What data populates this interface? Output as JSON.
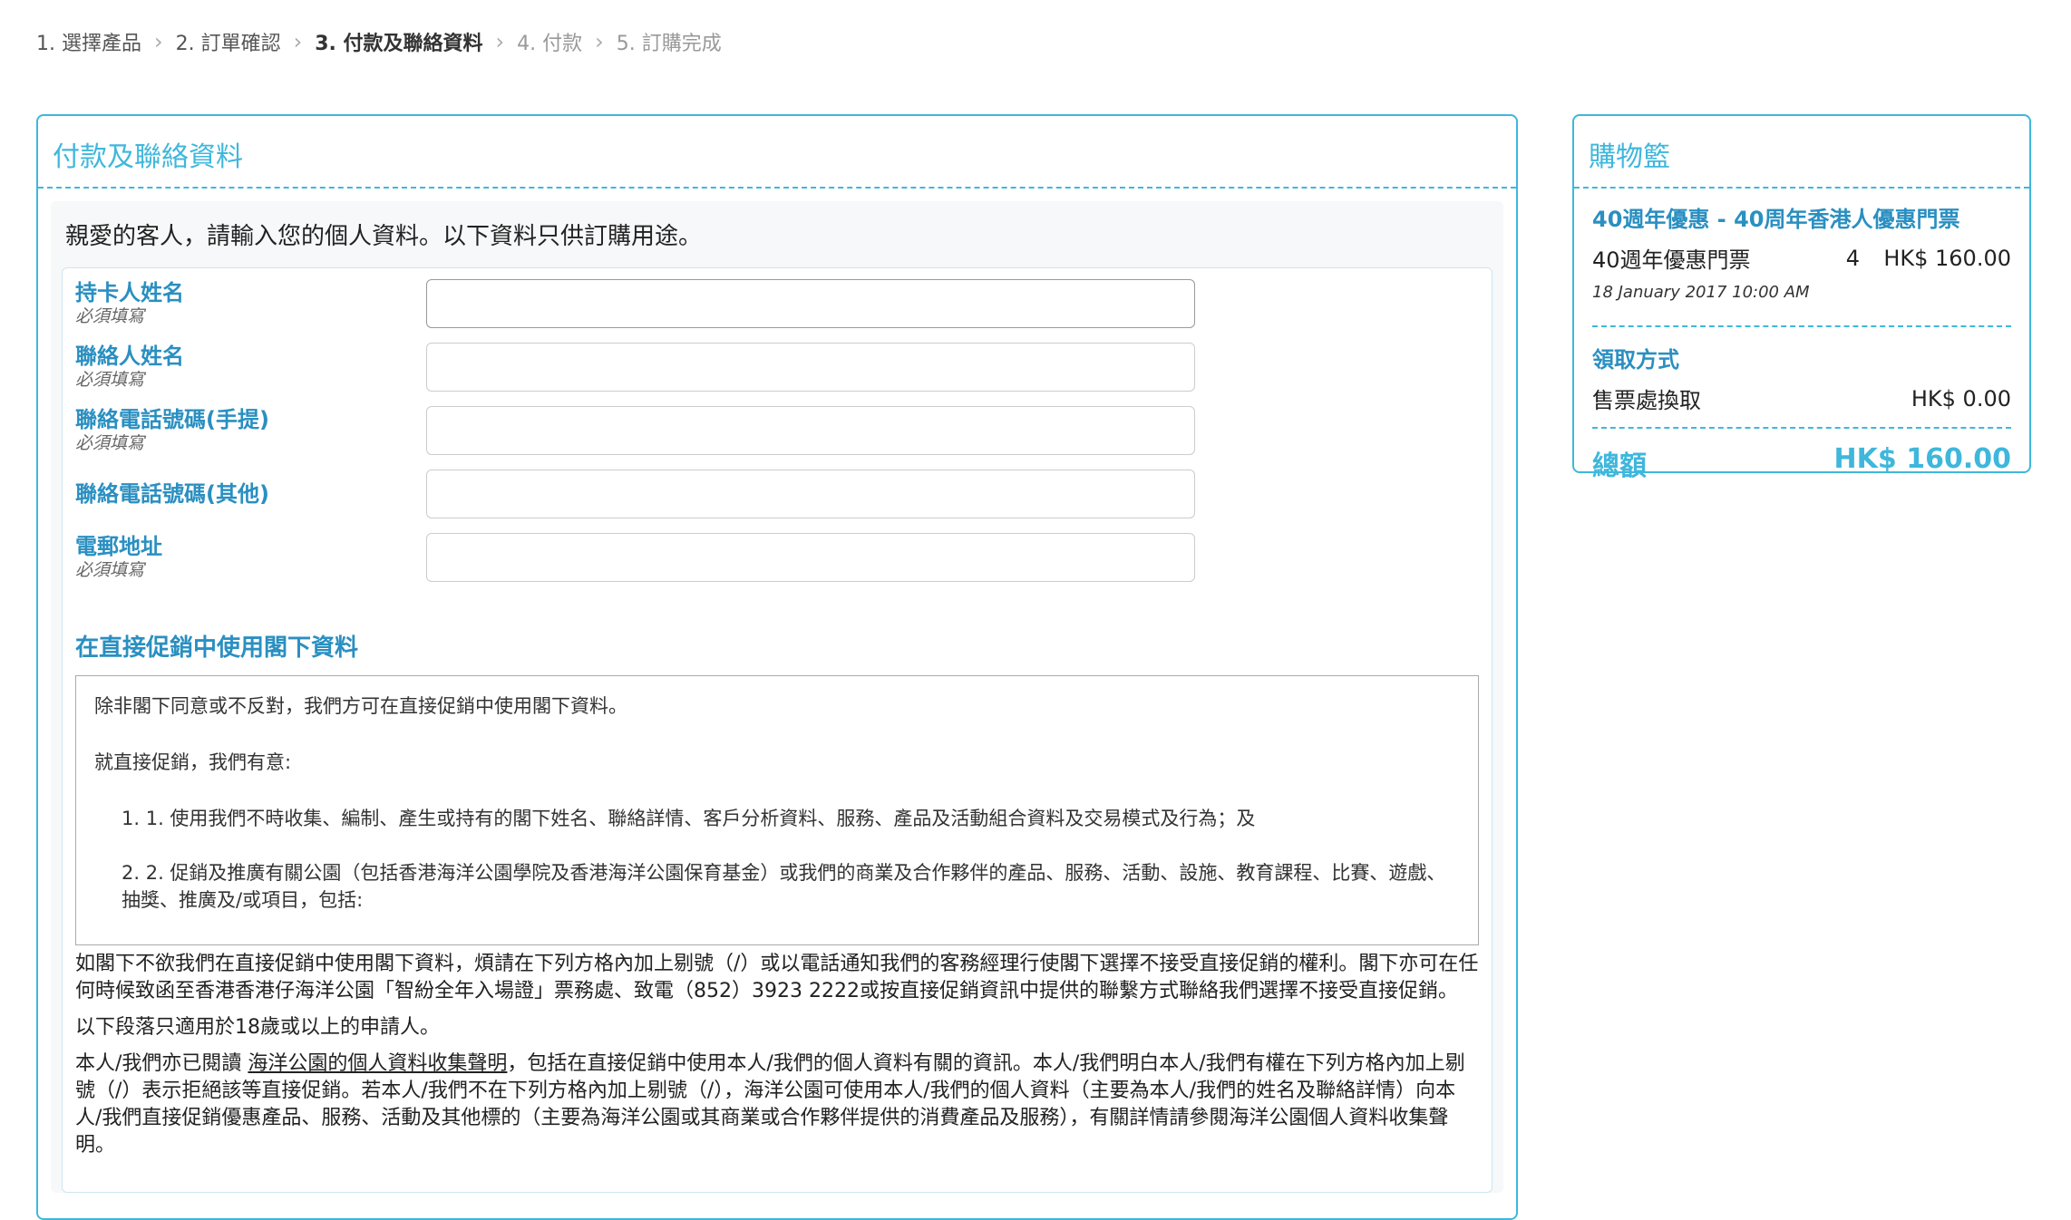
{
  "breadcrumb": {
    "steps": [
      "1. 選擇產品",
      "2. 訂單確認",
      "3. 付款及聯絡資料",
      "4. 付款",
      "5. 訂購完成"
    ],
    "separator": ">"
  },
  "main": {
    "title": "付款及聯絡資料",
    "intro": "親愛的客人，請輸入您的個人資料。以下資料只供訂購用途。",
    "fields": [
      {
        "label": "持卡人姓名",
        "required": "必須填寫",
        "value": ""
      },
      {
        "label": "聯絡人姓名",
        "required": "必須填寫",
        "value": ""
      },
      {
        "label": "聯絡電話號碼(手提)",
        "required": "必須填寫",
        "value": ""
      },
      {
        "label": "聯絡電話號碼(其他)",
        "required": "",
        "value": ""
      },
      {
        "label": "電郵地址",
        "required": "必須填寫",
        "value": ""
      }
    ],
    "direct_marketing": {
      "title": "在直接促銷中使用閣下資料",
      "box_p1": "除非閣下同意或不反對，我們方可在直接促銷中使用閣下資料。",
      "box_p2": "就直接促銷，我們有意:",
      "box_item1": "1. 1. 使用我們不時收集、編制、產生或持有的閣下姓名、聯絡詳情、客戶分析資料、服務、產品及活動組合資料及交易模式及行為；及",
      "box_item2": "2. 2. 促銷及推廣有關公園（包括香港海洋公園學院及香港海洋公園保育基金）或我們的商業及合作夥伴的產品、服務、活動、設施、教育課程、比賽、遊戲、抽獎、推廣及/或項目，包括:",
      "after_p1": "如閣下不欲我們在直接促銷中使用閣下資料，煩請在下列方格內加上剔號（/）或以電話通知我們的客務經理行使閣下選擇不接受直接促銷的權利。閣下亦可在任何時候致函至香港香港仔海洋公園「智紛全年入場證」票務處、致電（852）3923 2222或按直接促銷資訊中提供的聯繫方式聯絡我們選擇不接受直接促銷。",
      "after_p2": "以下段落只適用於18歲或以上的申請人。",
      "after_p3_prefix": "本人/我們亦已閱讀 ",
      "after_p3_link": "海洋公園的個人資料收集聲明",
      "after_p3_suffix": "，包括在直接促銷中使用本人/我們的個人資料有關的資訊。本人/我們明白本人/我們有權在下列方格內加上剔號（/）表示拒絕該等直接促銷。若本人/我們不在下列方格內加上剔號（/），海洋公園可使用本人/我們的個人資料（主要為本人/我們的姓名及聯絡詳情）向本人/我們直接促銷優惠產品、服務、活動及其他標的（主要為海洋公園或其商業或合作夥伴提供的消費產品及服務），有關詳情請參閱海洋公園個人資料收集聲明。"
    }
  },
  "cart": {
    "title": "購物籃",
    "product": "40週年優惠  - 40周年香港人優惠門票",
    "item_name": "40週年優惠門票",
    "item_qty": "4",
    "item_price": "HK$ 160.00",
    "item_date": "18 January 2017 10:00 AM",
    "pickup_title": "領取方式",
    "pickup_name": "售票處換取",
    "pickup_price": "HK$ 0.00",
    "total_label": "總額",
    "total_value": "HK$ 160.00"
  },
  "colors": {
    "accent": "#3fb7dc",
    "label": "#2a8fc1"
  }
}
